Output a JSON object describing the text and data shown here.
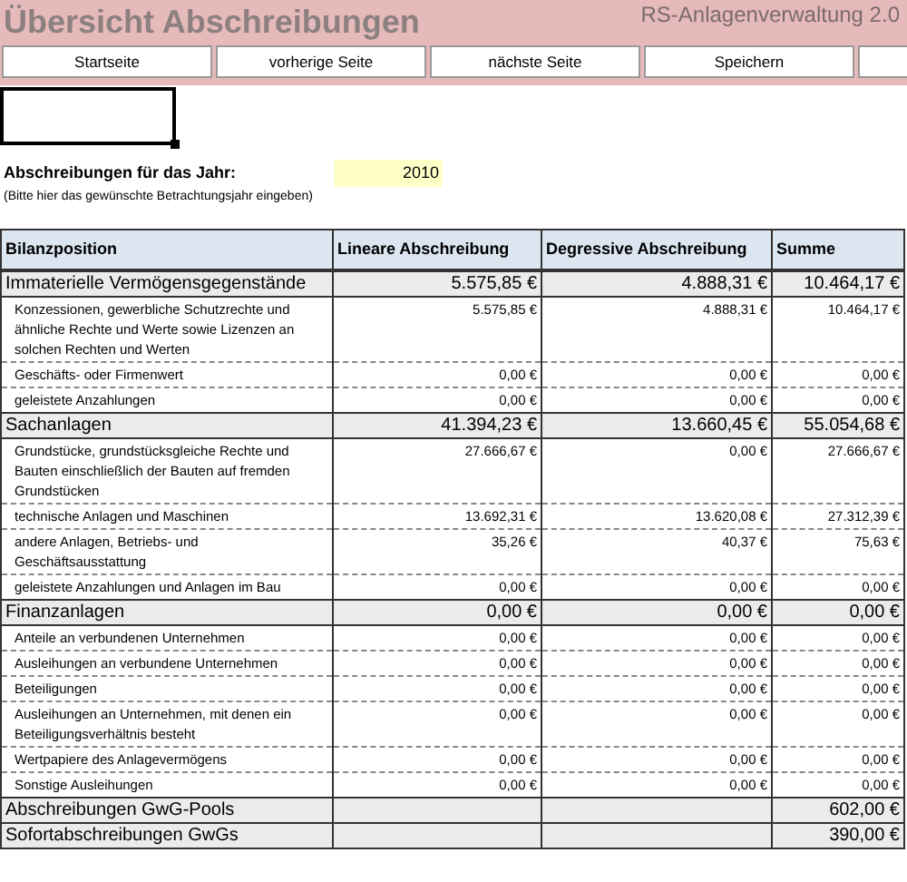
{
  "header": {
    "title": "Übersicht Abschreibungen",
    "app_name": "RS-Anlagenverwaltung 2.0"
  },
  "nav_buttons": [
    "Startseite",
    "vorherige Seite",
    "nächste Seite",
    "Speichern"
  ],
  "year": {
    "label": "Abschreibungen für das Jahr:",
    "value": "2010",
    "hint": "(Bitte hier das gewünschte Betrachtungsjahr eingeben)"
  },
  "table": {
    "columns": [
      "Bilanzposition",
      "Lineare Abschreibung",
      "Degressive Abschreibung",
      "Summe"
    ],
    "rows": [
      {
        "kind": "group",
        "label": "Immaterielle Vermögensgegenstände",
        "linear": "5.575,85 €",
        "degressive": "4.888,31 €",
        "total": "10.464,17 €"
      },
      {
        "kind": "item",
        "label": "Konzessionen, gewerbliche Schutzrechte und ähnliche Rechte und Werte sowie Lizenzen an solchen Rechten und Werten",
        "linear": "5.575,85 €",
        "degressive": "4.888,31 €",
        "total": "10.464,17 €"
      },
      {
        "kind": "item",
        "label": "Geschäfts- oder Firmenwert",
        "linear": "0,00 €",
        "degressive": "0,00 €",
        "total": "0,00 €"
      },
      {
        "kind": "item",
        "label": "geleistete Anzahlungen",
        "linear": "0,00 €",
        "degressive": "0,00 €",
        "total": "0,00 €"
      },
      {
        "kind": "group",
        "label": "Sachanlagen",
        "linear": "41.394,23 €",
        "degressive": "13.660,45 €",
        "total": "55.054,68 €"
      },
      {
        "kind": "item",
        "label": "Grundstücke, grundstücksgleiche Rechte und Bauten einschließlich der Bauten auf fremden Grundstücken",
        "linear": "27.666,67 €",
        "degressive": "0,00 €",
        "total": "27.666,67 €"
      },
      {
        "kind": "item",
        "label": "technische Anlagen und Maschinen",
        "linear": "13.692,31 €",
        "degressive": "13.620,08 €",
        "total": "27.312,39 €"
      },
      {
        "kind": "item",
        "label": "andere Anlagen, Betriebs- und Geschäftsausstattung",
        "linear": "35,26 €",
        "degressive": "40,37 €",
        "total": "75,63 €"
      },
      {
        "kind": "item",
        "label": "geleistete Anzahlungen und Anlagen im Bau",
        "linear": "0,00 €",
        "degressive": "0,00 €",
        "total": "0,00 €"
      },
      {
        "kind": "group",
        "label": "Finanzanlagen",
        "linear": "0,00 €",
        "degressive": "0,00 €",
        "total": "0,00 €"
      },
      {
        "kind": "item",
        "label": "Anteile an verbundenen Unternehmen",
        "linear": "0,00 €",
        "degressive": "0,00 €",
        "total": "0,00 €"
      },
      {
        "kind": "item",
        "label": "Ausleihungen an verbundene Unternehmen",
        "linear": "0,00 €",
        "degressive": "0,00 €",
        "total": "0,00 €"
      },
      {
        "kind": "item",
        "label": "Beteiligungen",
        "linear": "0,00 €",
        "degressive": "0,00 €",
        "total": "0,00 €"
      },
      {
        "kind": "item",
        "label": "Ausleihungen an Unternehmen, mit denen ein Beteiligungsverhältnis besteht",
        "linear": "0,00 €",
        "degressive": "0,00 €",
        "total": "0,00 €"
      },
      {
        "kind": "item",
        "label": "Wertpapiere des Anlagevermögens",
        "linear": "0,00 €",
        "degressive": "0,00 €",
        "total": "0,00 €"
      },
      {
        "kind": "item",
        "label": "Sonstige Ausleihungen",
        "linear": "0,00 €",
        "degressive": "0,00 €",
        "total": "0,00 €"
      },
      {
        "kind": "group",
        "label": "Abschreibungen GwG-Pools",
        "total": "602,00 €"
      },
      {
        "kind": "group",
        "label": "Sofortabschreibungen GwGs",
        "total": "390,00 €"
      }
    ]
  }
}
